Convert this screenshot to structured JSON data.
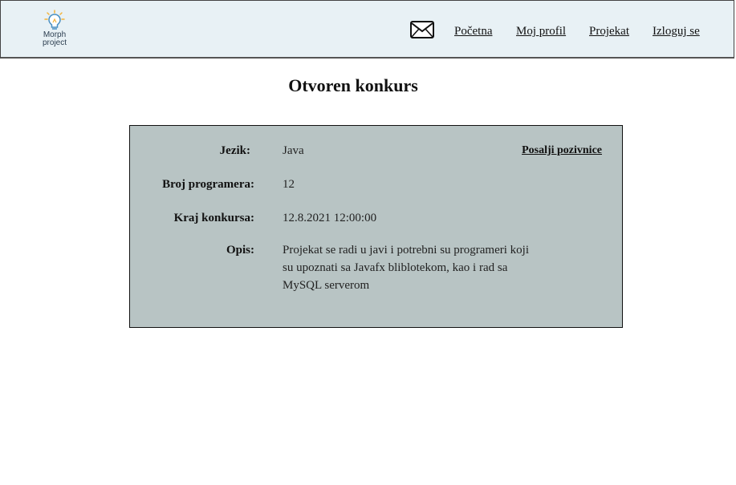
{
  "header": {
    "logo_text": "Morph\nproject",
    "mail_icon": "envelope-icon",
    "nav": [
      {
        "label": "Početna"
      },
      {
        "label": "Moj profil"
      },
      {
        "label": "Projekat"
      },
      {
        "label": "Izloguj se"
      }
    ]
  },
  "page": {
    "title": "Otvoren konkurs"
  },
  "details": {
    "language_label": "Jezik:",
    "language_value": "Java",
    "invite_link": "Posalji pozivnice",
    "programmers_label": "Broj programera:",
    "programmers_value": "12",
    "end_label": "Kraj konkursa:",
    "end_value": "12.8.2021 12:00:00",
    "description_label": "Opis:",
    "description_value": "Projekat se radi u javi i potrebni su programeri koji su upoznati sa Javafx bliblotekom, kao i rad sa MySQL serverom"
  },
  "colors": {
    "header_bg": "#e8f1f5",
    "card_bg": "#b8c4c4"
  }
}
